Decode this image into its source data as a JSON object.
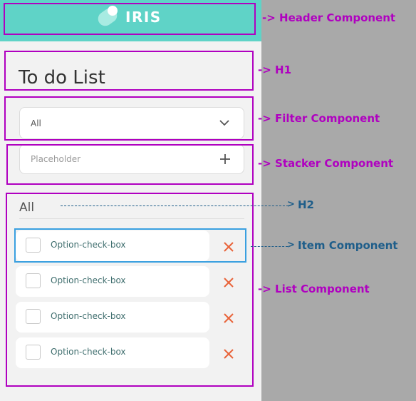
{
  "app": {
    "brand": "IRIS",
    "title": "To do List",
    "filter": {
      "value": "All"
    },
    "stacker": {
      "placeholder": "Placeholder"
    },
    "list": {
      "heading": "All",
      "items": [
        {
          "label": "Option-check-box"
        },
        {
          "label": "Option-check-box"
        },
        {
          "label": "Option-check-box"
        },
        {
          "label": "Option-check-box"
        }
      ]
    }
  },
  "annotations": {
    "header": "-> Header Component",
    "h1": "-> H1",
    "filter": "-> Filter Component",
    "stacker": "-> Stacker Component",
    "h2": "H2",
    "item": "Item Component",
    "list": "-> List Component"
  },
  "colors": {
    "header_bg": "#5fd3c7",
    "annotation_magenta": "#b000c0",
    "annotation_blue": "#1f5e8a",
    "item_highlight": "#3aa0e0",
    "delete_x": "#e8643a"
  }
}
